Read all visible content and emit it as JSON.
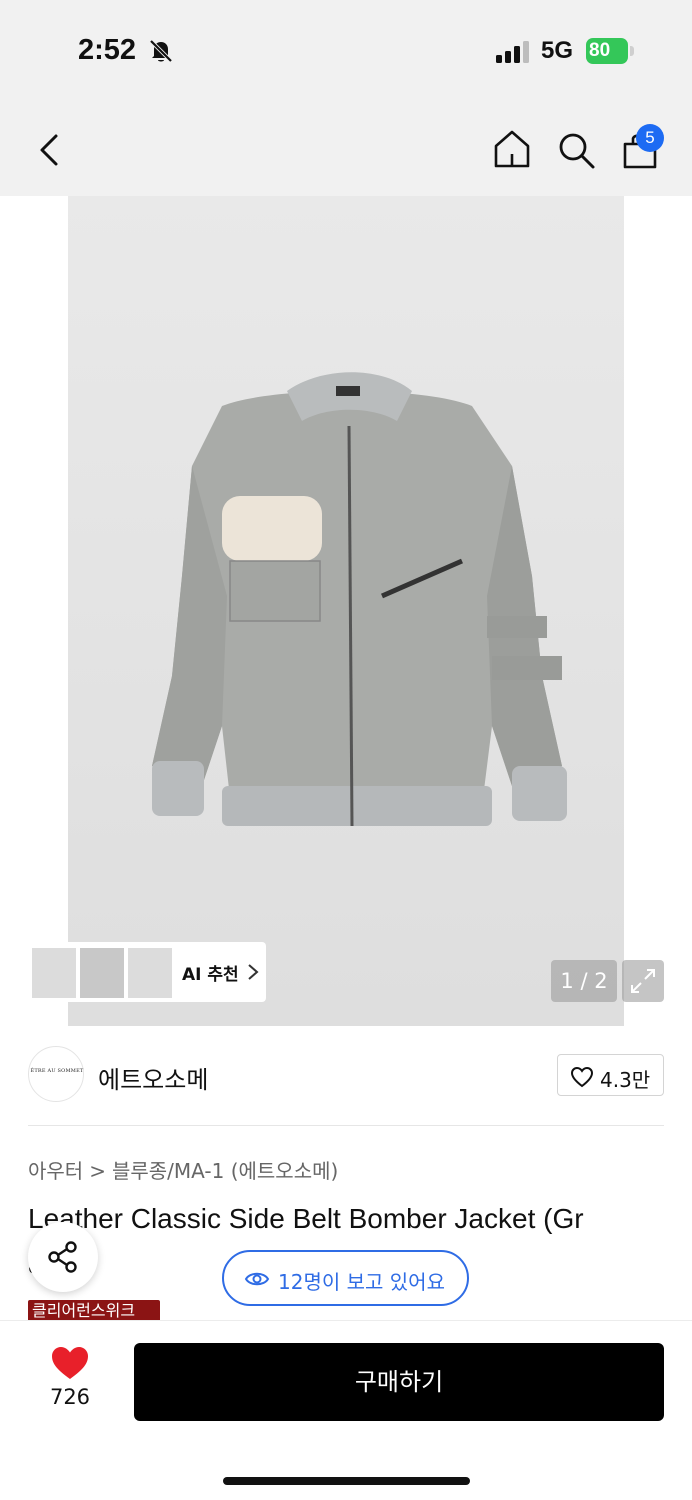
{
  "status_bar": {
    "time": "2:52",
    "network": "5G",
    "battery": "80",
    "icons": [
      "bell-off-icon",
      "signal-icon",
      "battery-charging-icon"
    ]
  },
  "header": {
    "icons": [
      "back-icon",
      "home-icon",
      "search-icon",
      "shopping-bag-icon"
    ],
    "cart_count": "5"
  },
  "gallery": {
    "ai_label": "AI 추천",
    "page_indicator": "1 / 2",
    "expand_icon": "expand-icon"
  },
  "brand": {
    "logo_text": "ÊTRE AU SOMMET",
    "name": "에트오소메",
    "like_count": "4.3만"
  },
  "breadcrumb": {
    "items": [
      "아우터",
      "블루종/MA-1 (에트오소메)"
    ],
    "separator": ">"
  },
  "product": {
    "title": "Leather Classic Side Belt Bomber Jacket (Gr",
    "title_line2": "a"
  },
  "floating": {
    "viewers_text": "12명이 보고 있어요",
    "promo_badge": "클리어런스위크"
  },
  "bottom_bar": {
    "wish_count": "726",
    "buy_label": "구매하기"
  },
  "colors": {
    "accent_blue": "#2f6ce5",
    "wish_red": "#e8202a",
    "promo_red": "#8b1414",
    "battery_green": "#34c759"
  }
}
